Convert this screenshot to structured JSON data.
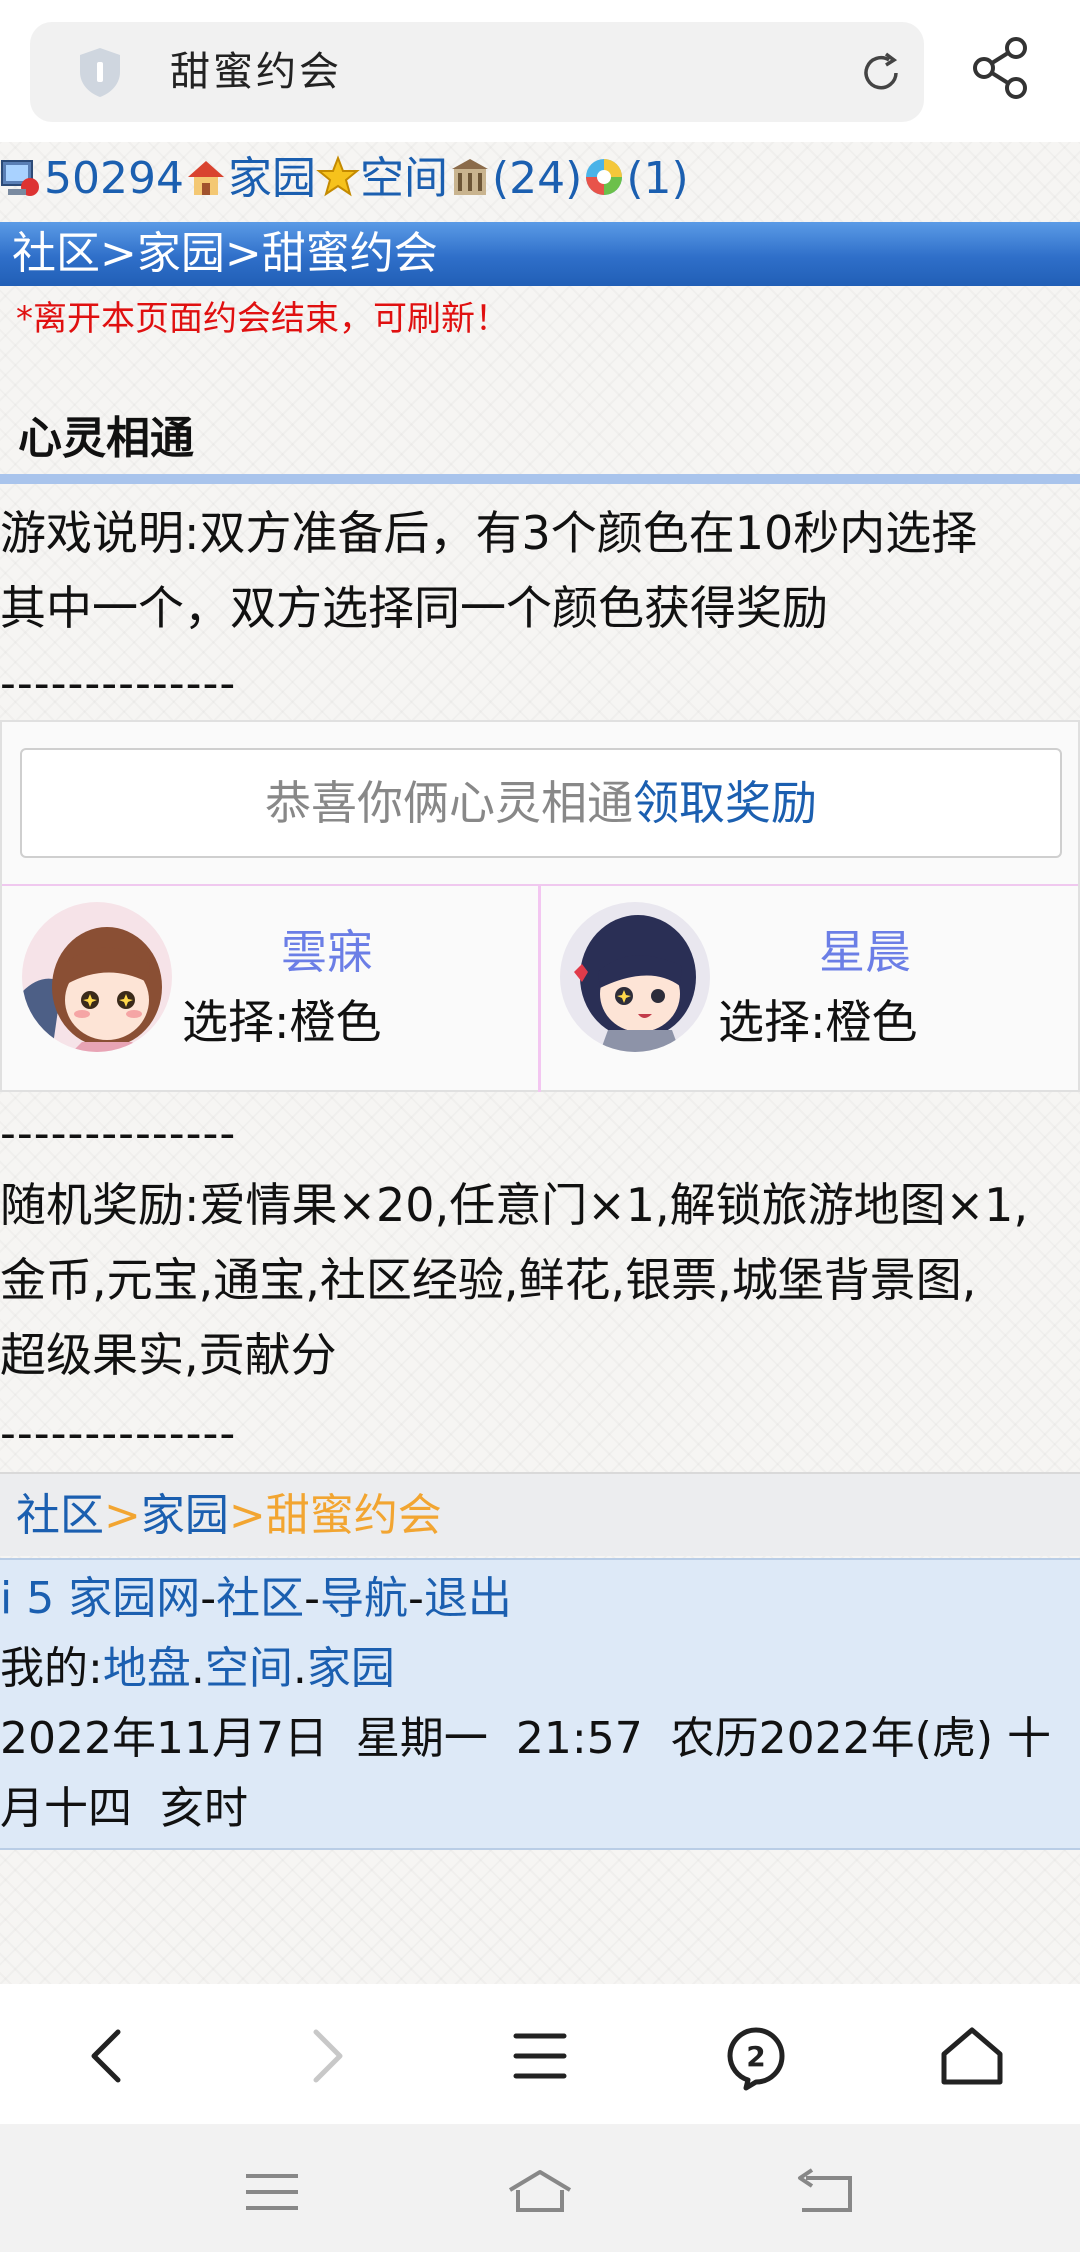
{
  "browser": {
    "page_title": "甜蜜约会",
    "tabs_count": "2"
  },
  "status": {
    "user_id": "50294",
    "home_label": "家园",
    "space_label": "空间",
    "building_count": "(24)",
    "circle_count": "(1)"
  },
  "breadcrumb_top": "社区>家园>甜蜜约会",
  "warning": "*离开本页面约会结束，可刷新！",
  "section_title": "心灵相通",
  "game_desc_line1": "游戏说明:双方准备后，有3个颜色在10秒内选择",
  "game_desc_line2": "其中一个，双方选择同一个颜色获得奖励",
  "dashes": "--------------",
  "result": {
    "message": "恭喜你俩心灵相通",
    "link": "领取奖励"
  },
  "players": [
    {
      "name": "雲寐",
      "choice": "选择:橙色"
    },
    {
      "name": "星晨",
      "choice": "选择:橙色"
    }
  ],
  "rewards_line1": "随机奖励:爱情果×20,任意门×1,解锁旅游地图×1,",
  "rewards_line2": "金币,元宝,通宝,社区经验,鲜花,银票,城堡背景图,",
  "rewards_line3": "超级果实,贡献分",
  "breadcrumb_bottom": {
    "item1": "社区",
    "sep": ">",
    "item2": "家园",
    "current": "甜蜜约会"
  },
  "footer": {
    "site": "i 5 家园网",
    "community": "社区",
    "nav": "导航",
    "logout": "退出",
    "dash": "-",
    "mine_label": "我的:",
    "turf": "地盘",
    "space": "空间",
    "home": "家园",
    "dot": ".",
    "datetime_line1": "2022年11月7日  星期一  21:57  农历2022年(虎) 十",
    "datetime_line2": "月十四  亥时"
  },
  "colors": {
    "accent_blue": "#2f6fc9",
    "link_blue": "#1b5fb0",
    "warning_red": "#e01010",
    "player_name": "#6b7ee6",
    "breadcrumb_orange": "#f2a531"
  },
  "icons": [
    "shield-icon",
    "reload-icon",
    "share-icon",
    "computer-icon",
    "home-icon",
    "star-icon",
    "building-icon",
    "colorwheel-icon",
    "back-icon",
    "forward-icon",
    "menu-icon",
    "tabs-icon",
    "home-nav-icon",
    "sys-menu-icon",
    "sys-home-icon",
    "sys-back-icon"
  ]
}
